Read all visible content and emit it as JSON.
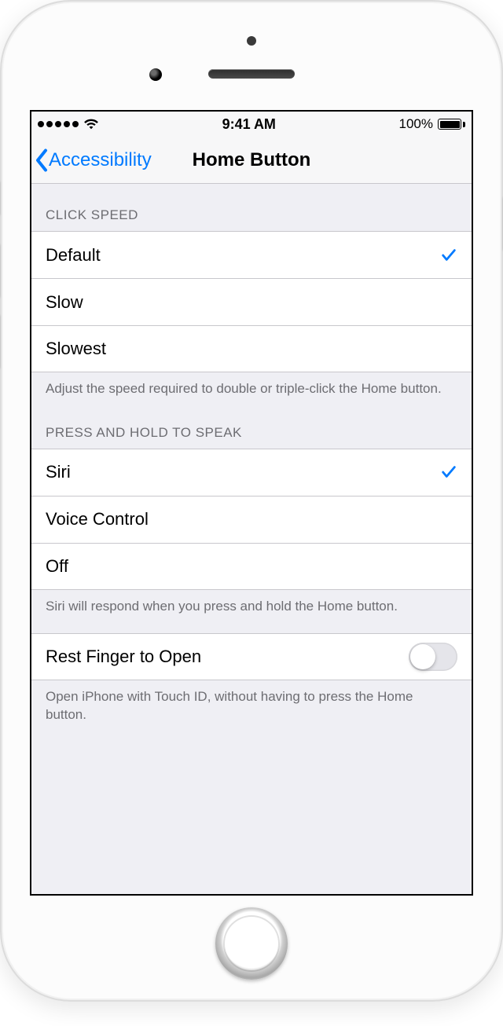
{
  "status_bar": {
    "time": "9:41 AM",
    "battery_pct": "100%"
  },
  "navbar": {
    "back_label": "Accessibility",
    "title": "Home Button"
  },
  "sections": {
    "click_speed": {
      "header": "CLICK SPEED",
      "options": [
        "Default",
        "Slow",
        "Slowest"
      ],
      "selected_index": 0,
      "footer": "Adjust the speed required to double or triple-click the Home button."
    },
    "press_hold": {
      "header": "PRESS AND HOLD TO SPEAK",
      "options": [
        "Siri",
        "Voice Control",
        "Off"
      ],
      "selected_index": 0,
      "footer": "Siri will respond when you press and hold the Home button."
    },
    "rest_finger": {
      "label": "Rest Finger to Open",
      "value": false,
      "footer": "Open iPhone with Touch ID, without having to press the Home button."
    }
  }
}
